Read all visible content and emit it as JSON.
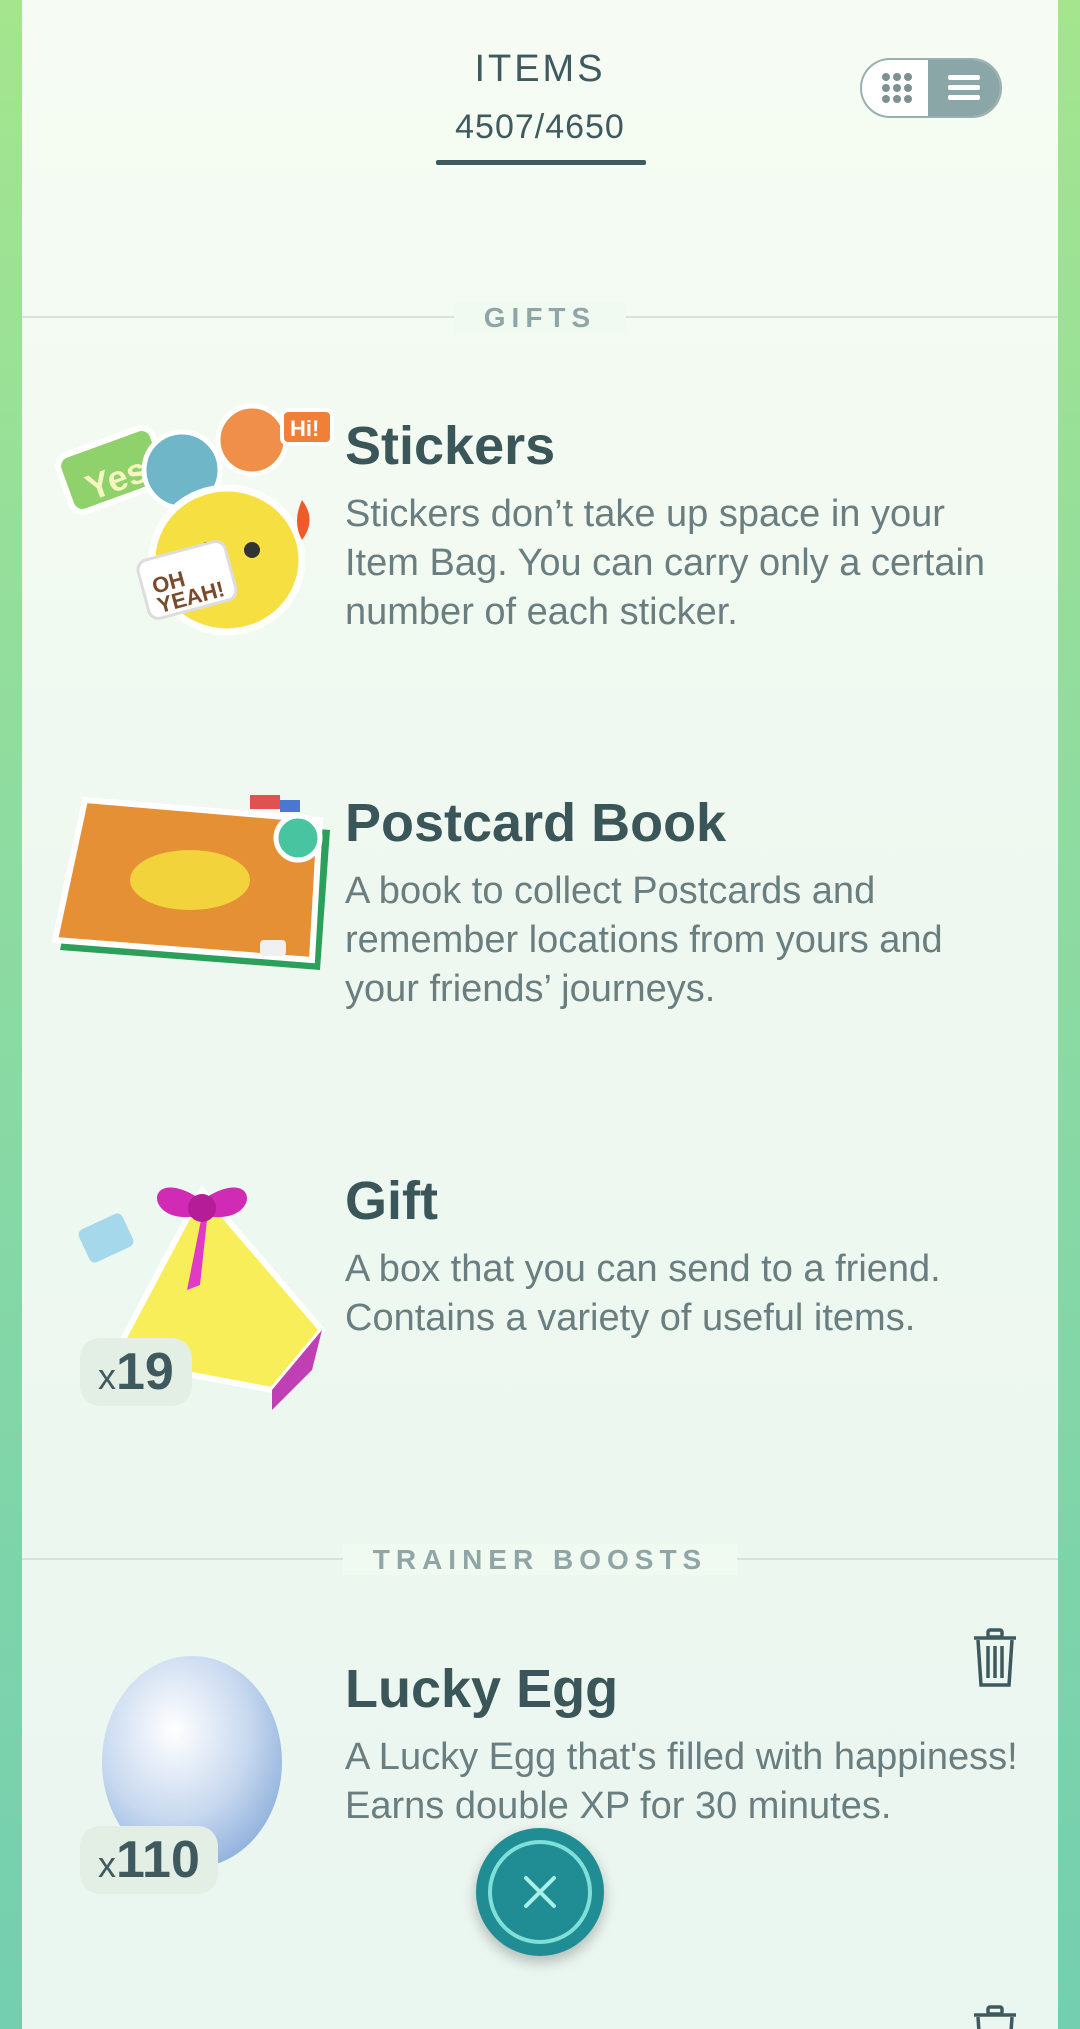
{
  "header": {
    "title": "ITEMS",
    "count": "4507/4650"
  },
  "sections": {
    "gifts": "GIFTS",
    "trainer_boosts": "TRAINER BOOSTS"
  },
  "items": [
    {
      "title": "Stickers",
      "desc": "Stickers don’t take up space in your Item Bag. You can carry only a certain number of each sticker."
    },
    {
      "title": "Postcard Book",
      "desc": "A book to collect Postcards and remember locations from yours and your friends’ journeys."
    },
    {
      "title": "Gift",
      "desc": "A box that you can send to a friend. Contains a variety of useful items.",
      "qty_prefix": "x",
      "qty": "19"
    },
    {
      "title": "Lucky Egg",
      "desc": "A Lucky Egg that's filled with happiness! Earns double XP for 30 minutes.",
      "qty_prefix": "x",
      "qty": "110"
    }
  ],
  "icons": [
    "grid-view-icon",
    "list-view-icon",
    "stickers-icon",
    "postcard-book-icon",
    "gift-icon",
    "lucky-egg-icon",
    "trash-icon",
    "close-icon"
  ],
  "colors": {
    "accent": "#1f8d93",
    "text": "#3a5659"
  }
}
